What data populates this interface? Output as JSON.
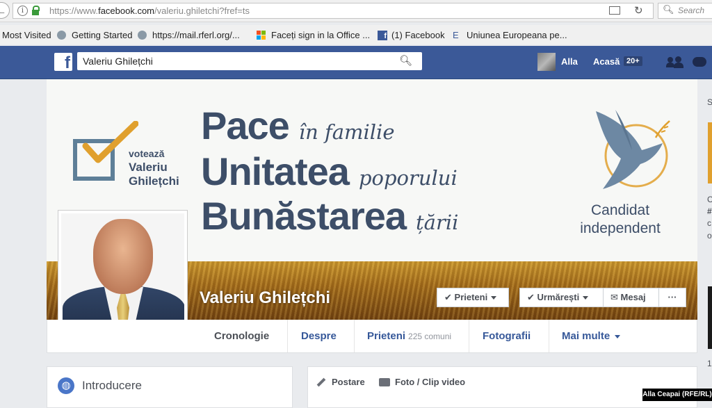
{
  "browser": {
    "url_prefix": "https://www.",
    "url_domain": "facebook.com",
    "url_path": "/valeriu.ghiletchi?fref=ts",
    "search_placeholder": "Search",
    "back_glyph": "←",
    "bookmarks": [
      {
        "label": "Most Visited",
        "icon": "none"
      },
      {
        "label": "Getting Started",
        "icon": "globe-icon"
      },
      {
        "label": "https://mail.rferl.org/...",
        "icon": "globe-icon"
      },
      {
        "label": "Faceți sign in la Office ...",
        "icon": "microsoft-icon"
      },
      {
        "label": "(1) Facebook",
        "icon": "facebook-icon"
      },
      {
        "label": "Uniunea Europeana pe...",
        "icon": "e-icon"
      }
    ],
    "ms_colors": [
      "#f25022",
      "#7fba00",
      "#00a4ef",
      "#ffb900"
    ]
  },
  "fb": {
    "logo_letter": "f",
    "search_value": "Valeriu Ghilețchi",
    "user_name": "Alla",
    "home_label": "Acasă",
    "home_badge": "20+",
    "brand_color": "#3b5998"
  },
  "cover": {
    "vote_line1": "votează",
    "vote_line2": "Valeriu",
    "vote_line3": "Ghilețchi",
    "slogan": [
      {
        "big": "Pace",
        "small": "în familie"
      },
      {
        "big": "Unitatea",
        "small": "poporului"
      },
      {
        "big": "Bunăstarea",
        "small": "țării"
      }
    ],
    "candidate_line1": "Candidat",
    "candidate_line2": "independent",
    "text_color": "#3d4e68",
    "check_color": "#e0a02e"
  },
  "profile": {
    "name": "Valeriu Ghilețchi",
    "buttons": {
      "friends": "Prieteni",
      "follow": "Urmărești",
      "message": "Mesaj",
      "more": "···"
    }
  },
  "tabs": [
    {
      "label": "Cronologie"
    },
    {
      "label": "Despre"
    },
    {
      "label": "Prieteni",
      "count": "225 comuni"
    },
    {
      "label": "Fotografii"
    },
    {
      "label": "Mai multe"
    }
  ],
  "intro": {
    "label": "Introducere"
  },
  "composer": {
    "post": "Postare",
    "photo": "Foto / Clip video"
  },
  "right_column": {
    "letters": [
      "S",
      "C",
      "#",
      "c",
      "o",
      "1"
    ]
  },
  "credit": "Alla Ceapai (RFE/RL)"
}
